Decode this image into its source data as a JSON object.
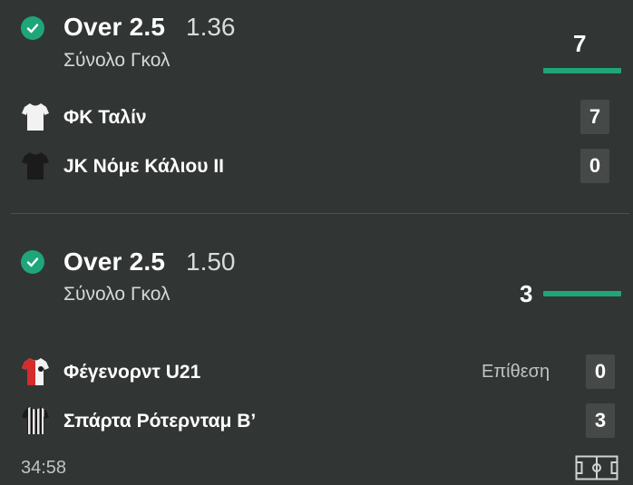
{
  "markets": [
    {
      "title": "Over 2.5",
      "odds": "1.36",
      "subtitle": "Σύνολο Γκολ",
      "total_score": "7",
      "teams": [
        {
          "name": "ΦΚ Ταλίν",
          "score": "7",
          "shirt": "white-shirt-icon"
        },
        {
          "name": "JK Νόμε Κάλιου II",
          "score": "0",
          "shirt": "black-shirt-icon"
        }
      ]
    },
    {
      "title": "Over 2.5",
      "odds": "1.50",
      "subtitle": "Σύνολο Γκολ",
      "total_score": "3",
      "attack_label": "Επίθεση",
      "teams": [
        {
          "name": "Φέγενορντ U21",
          "score": "0",
          "shirt": "red-white-shirt-icon"
        },
        {
          "name": "Σπάρτα Ρότερνταμ Β’",
          "score": "3",
          "shirt": "black-white-striped-shirt-icon"
        }
      ]
    }
  ],
  "match_time": "34:58",
  "colors": {
    "background": "#313533",
    "accent": "#1fa57a",
    "score_box": "#454947"
  }
}
